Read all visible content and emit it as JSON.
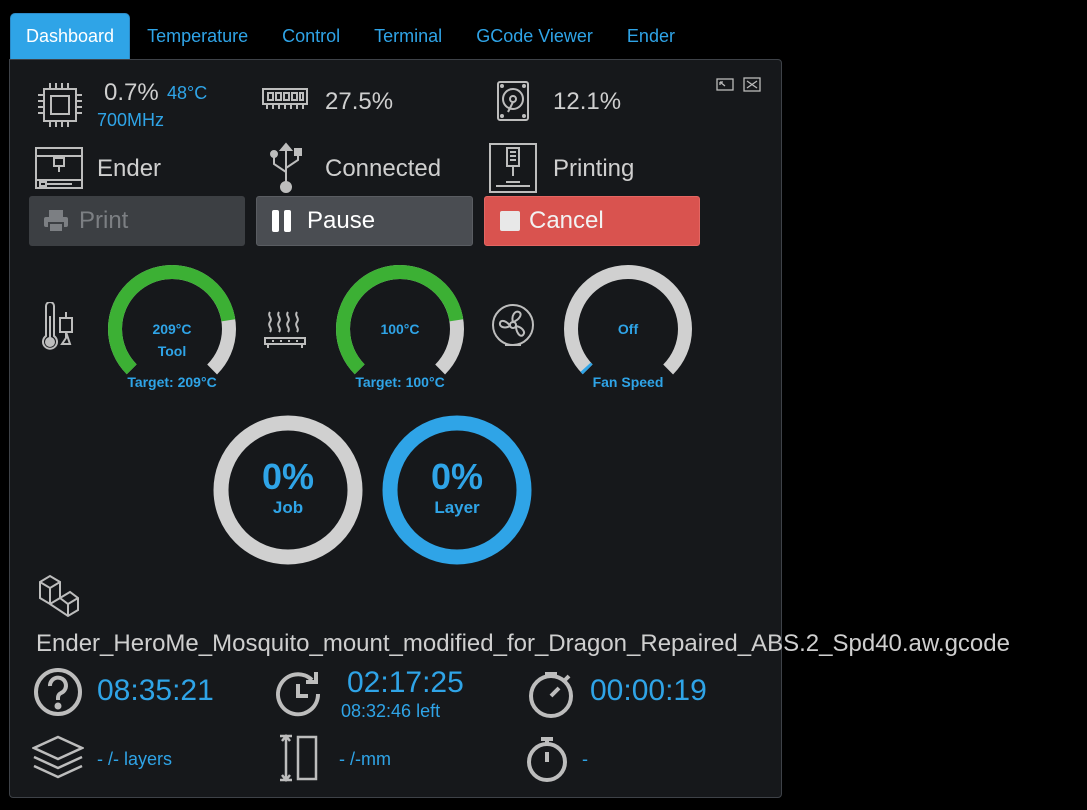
{
  "tabs": [
    {
      "label": "Dashboard",
      "active": true
    },
    {
      "label": "Temperature"
    },
    {
      "label": "Control"
    },
    {
      "label": "Terminal"
    },
    {
      "label": "GCode Viewer"
    },
    {
      "label": "Ender"
    }
  ],
  "system": {
    "cpu_usage": "0.7%",
    "cpu_temp": "48°C",
    "cpu_freq": "700MHz",
    "memory_usage": "27.5%",
    "disk_usage": "12.1%"
  },
  "printer": {
    "name": "Ender",
    "connection": "Connected",
    "state": "Printing"
  },
  "buttons": {
    "print": "Print",
    "pause": "Pause",
    "cancel": "Cancel"
  },
  "gauges": {
    "tool": {
      "value": "209°C",
      "label": "Tool",
      "target": "Target: 209°C",
      "fill_fraction": 0.8
    },
    "bed": {
      "value": "100°C",
      "label": "",
      "target": "Target: 100°C",
      "fill_fraction": 0.8
    },
    "fan": {
      "value": "Off",
      "label": "Fan Speed",
      "fill_fraction": 0.0
    }
  },
  "progress": {
    "job": {
      "value": "0%",
      "label": "Job",
      "fraction": 0.0
    },
    "layer": {
      "value": "0%",
      "label": "Layer",
      "fraction": 0.0
    }
  },
  "file": {
    "name": "Ender_HeroMe_Mosquito_mount_modified_for_Dragon_Repaired_ABS.2_Spd40.aw.gcode"
  },
  "times": {
    "estimated_total": "08:35:21",
    "remaining": "02:17:25",
    "remaining_left": "08:32:46 left",
    "elapsed": "00:00:19"
  },
  "layers": {
    "layers_text": "- /- layers",
    "height_text": "- /-mm",
    "layer_time": "-"
  },
  "colors": {
    "accent": "#2fa4e7",
    "gauge_fill": "#3cb034",
    "gauge_track": "#d0d0d0",
    "cancel": "#d9534f"
  },
  "icons": {
    "fullscreen": "fullscreen-icon",
    "expand": "expand-icon"
  }
}
